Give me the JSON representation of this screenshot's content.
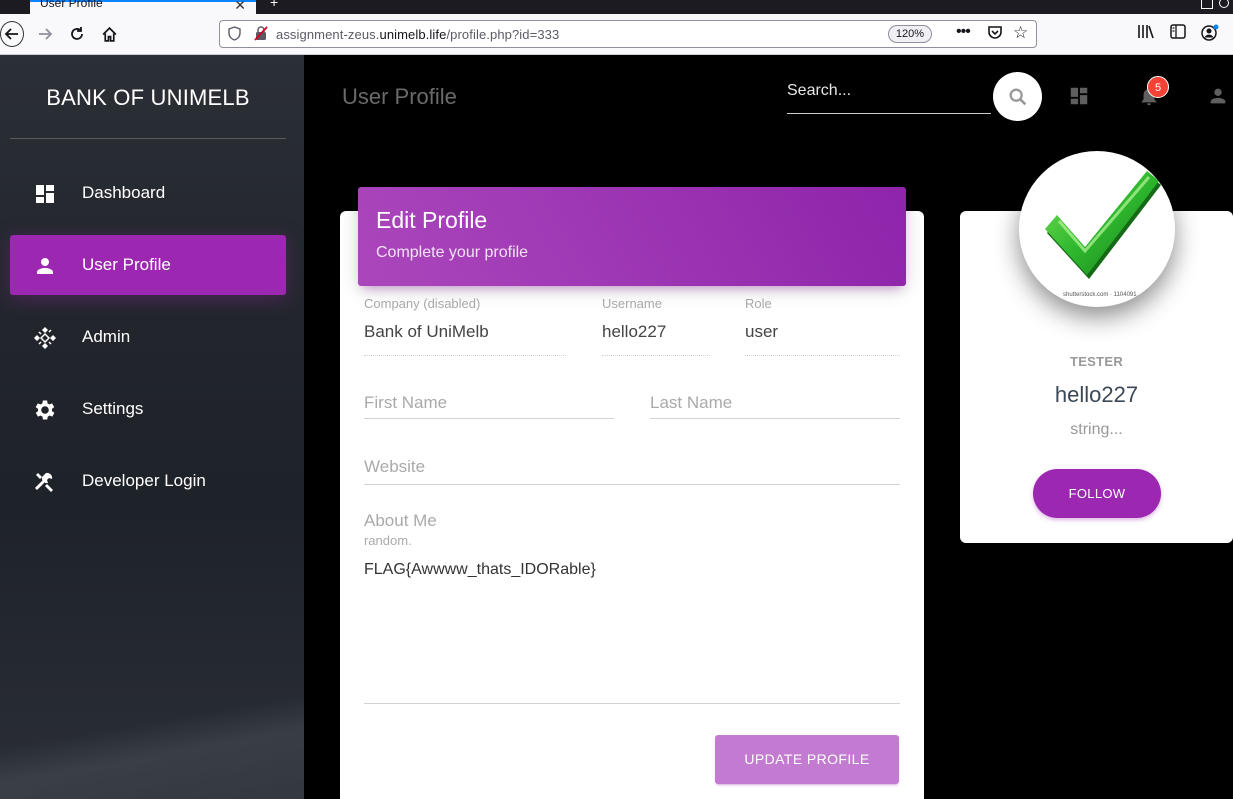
{
  "browser": {
    "tab_title": "User Profile",
    "tab_close": "✕",
    "new_tab": "+",
    "url_host_pre": "assignment-zeus.",
    "url_host_bold": "unimelb.life",
    "url_path": "/profile.php?id=333",
    "zoom": "120%"
  },
  "sidebar": {
    "brand": "BANK OF UNIMELB",
    "items": [
      {
        "label": "Dashboard",
        "icon": "dashboard-icon"
      },
      {
        "label": "User Profile",
        "icon": "person-icon",
        "active": true
      },
      {
        "label": "Admin",
        "icon": "admin-icon"
      },
      {
        "label": "Settings",
        "icon": "gear-icon"
      },
      {
        "label": "Developer Login",
        "icon": "tools-icon"
      }
    ]
  },
  "header": {
    "title": "User Profile",
    "search_placeholder": "Search...",
    "notification_count": "5"
  },
  "edit_profile": {
    "title": "Edit Profile",
    "subtitle": "Complete your profile",
    "company_label": "Company (disabled)",
    "company_value": "Bank of UniMelb",
    "username_label": "Username",
    "username_value": "hello227",
    "role_label": "Role",
    "role_value": "user",
    "first_name_placeholder": "First Name",
    "last_name_placeholder": "Last Name",
    "website_placeholder": "Website",
    "about_label": "About Me",
    "about_sub": "random.",
    "about_value": "FLAG{Awwww_thats_IDORable}",
    "update_button": "UPDATE PROFILE"
  },
  "profile_card": {
    "watermark": "shutterstock.com · 1104091",
    "category": "TESTER",
    "name": "hello227",
    "description": "string...",
    "follow_button": "FOLLOW"
  },
  "colors": {
    "accent": "#9c27b0",
    "badge": "#f44336",
    "check_green": "#2eb82e"
  }
}
